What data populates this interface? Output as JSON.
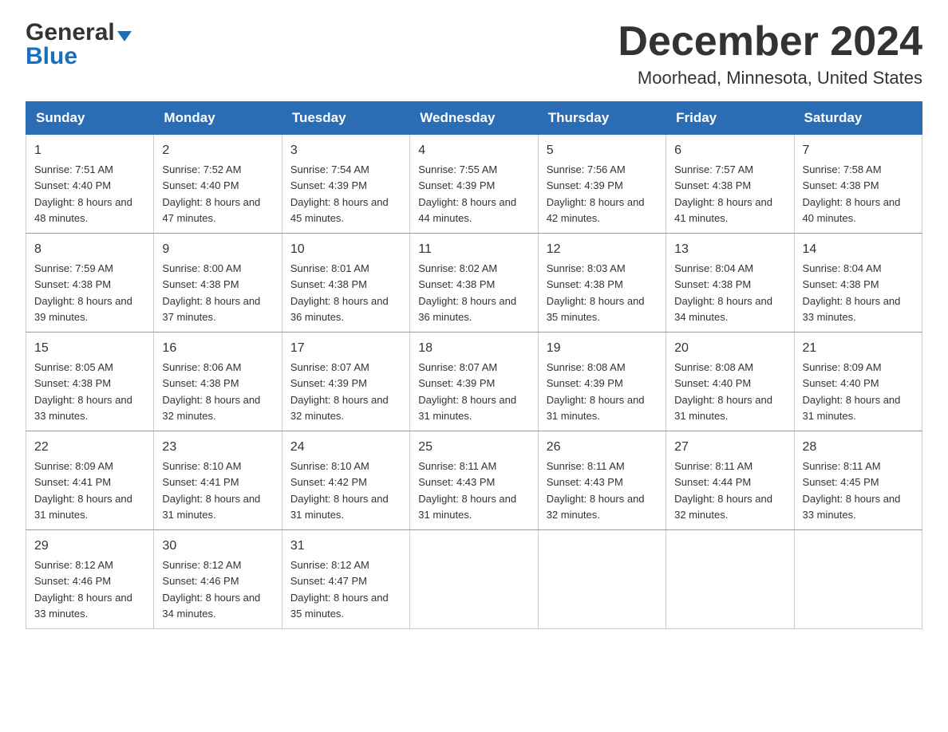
{
  "logo": {
    "general": "General",
    "blue": "Blue"
  },
  "title": "December 2024",
  "subtitle": "Moorhead, Minnesota, United States",
  "weekdays": [
    "Sunday",
    "Monday",
    "Tuesday",
    "Wednesday",
    "Thursday",
    "Friday",
    "Saturday"
  ],
  "weeks": [
    [
      {
        "day": "1",
        "sunrise": "7:51 AM",
        "sunset": "4:40 PM",
        "daylight": "8 hours and 48 minutes."
      },
      {
        "day": "2",
        "sunrise": "7:52 AM",
        "sunset": "4:40 PM",
        "daylight": "8 hours and 47 minutes."
      },
      {
        "day": "3",
        "sunrise": "7:54 AM",
        "sunset": "4:39 PM",
        "daylight": "8 hours and 45 minutes."
      },
      {
        "day": "4",
        "sunrise": "7:55 AM",
        "sunset": "4:39 PM",
        "daylight": "8 hours and 44 minutes."
      },
      {
        "day": "5",
        "sunrise": "7:56 AM",
        "sunset": "4:39 PM",
        "daylight": "8 hours and 42 minutes."
      },
      {
        "day": "6",
        "sunrise": "7:57 AM",
        "sunset": "4:38 PM",
        "daylight": "8 hours and 41 minutes."
      },
      {
        "day": "7",
        "sunrise": "7:58 AM",
        "sunset": "4:38 PM",
        "daylight": "8 hours and 40 minutes."
      }
    ],
    [
      {
        "day": "8",
        "sunrise": "7:59 AM",
        "sunset": "4:38 PM",
        "daylight": "8 hours and 39 minutes."
      },
      {
        "day": "9",
        "sunrise": "8:00 AM",
        "sunset": "4:38 PM",
        "daylight": "8 hours and 37 minutes."
      },
      {
        "day": "10",
        "sunrise": "8:01 AM",
        "sunset": "4:38 PM",
        "daylight": "8 hours and 36 minutes."
      },
      {
        "day": "11",
        "sunrise": "8:02 AM",
        "sunset": "4:38 PM",
        "daylight": "8 hours and 36 minutes."
      },
      {
        "day": "12",
        "sunrise": "8:03 AM",
        "sunset": "4:38 PM",
        "daylight": "8 hours and 35 minutes."
      },
      {
        "day": "13",
        "sunrise": "8:04 AM",
        "sunset": "4:38 PM",
        "daylight": "8 hours and 34 minutes."
      },
      {
        "day": "14",
        "sunrise": "8:04 AM",
        "sunset": "4:38 PM",
        "daylight": "8 hours and 33 minutes."
      }
    ],
    [
      {
        "day": "15",
        "sunrise": "8:05 AM",
        "sunset": "4:38 PM",
        "daylight": "8 hours and 33 minutes."
      },
      {
        "day": "16",
        "sunrise": "8:06 AM",
        "sunset": "4:38 PM",
        "daylight": "8 hours and 32 minutes."
      },
      {
        "day": "17",
        "sunrise": "8:07 AM",
        "sunset": "4:39 PM",
        "daylight": "8 hours and 32 minutes."
      },
      {
        "day": "18",
        "sunrise": "8:07 AM",
        "sunset": "4:39 PM",
        "daylight": "8 hours and 31 minutes."
      },
      {
        "day": "19",
        "sunrise": "8:08 AM",
        "sunset": "4:39 PM",
        "daylight": "8 hours and 31 minutes."
      },
      {
        "day": "20",
        "sunrise": "8:08 AM",
        "sunset": "4:40 PM",
        "daylight": "8 hours and 31 minutes."
      },
      {
        "day": "21",
        "sunrise": "8:09 AM",
        "sunset": "4:40 PM",
        "daylight": "8 hours and 31 minutes."
      }
    ],
    [
      {
        "day": "22",
        "sunrise": "8:09 AM",
        "sunset": "4:41 PM",
        "daylight": "8 hours and 31 minutes."
      },
      {
        "day": "23",
        "sunrise": "8:10 AM",
        "sunset": "4:41 PM",
        "daylight": "8 hours and 31 minutes."
      },
      {
        "day": "24",
        "sunrise": "8:10 AM",
        "sunset": "4:42 PM",
        "daylight": "8 hours and 31 minutes."
      },
      {
        "day": "25",
        "sunrise": "8:11 AM",
        "sunset": "4:43 PM",
        "daylight": "8 hours and 31 minutes."
      },
      {
        "day": "26",
        "sunrise": "8:11 AM",
        "sunset": "4:43 PM",
        "daylight": "8 hours and 32 minutes."
      },
      {
        "day": "27",
        "sunrise": "8:11 AM",
        "sunset": "4:44 PM",
        "daylight": "8 hours and 32 minutes."
      },
      {
        "day": "28",
        "sunrise": "8:11 AM",
        "sunset": "4:45 PM",
        "daylight": "8 hours and 33 minutes."
      }
    ],
    [
      {
        "day": "29",
        "sunrise": "8:12 AM",
        "sunset": "4:46 PM",
        "daylight": "8 hours and 33 minutes."
      },
      {
        "day": "30",
        "sunrise": "8:12 AM",
        "sunset": "4:46 PM",
        "daylight": "8 hours and 34 minutes."
      },
      {
        "day": "31",
        "sunrise": "8:12 AM",
        "sunset": "4:47 PM",
        "daylight": "8 hours and 35 minutes."
      },
      null,
      null,
      null,
      null
    ]
  ]
}
